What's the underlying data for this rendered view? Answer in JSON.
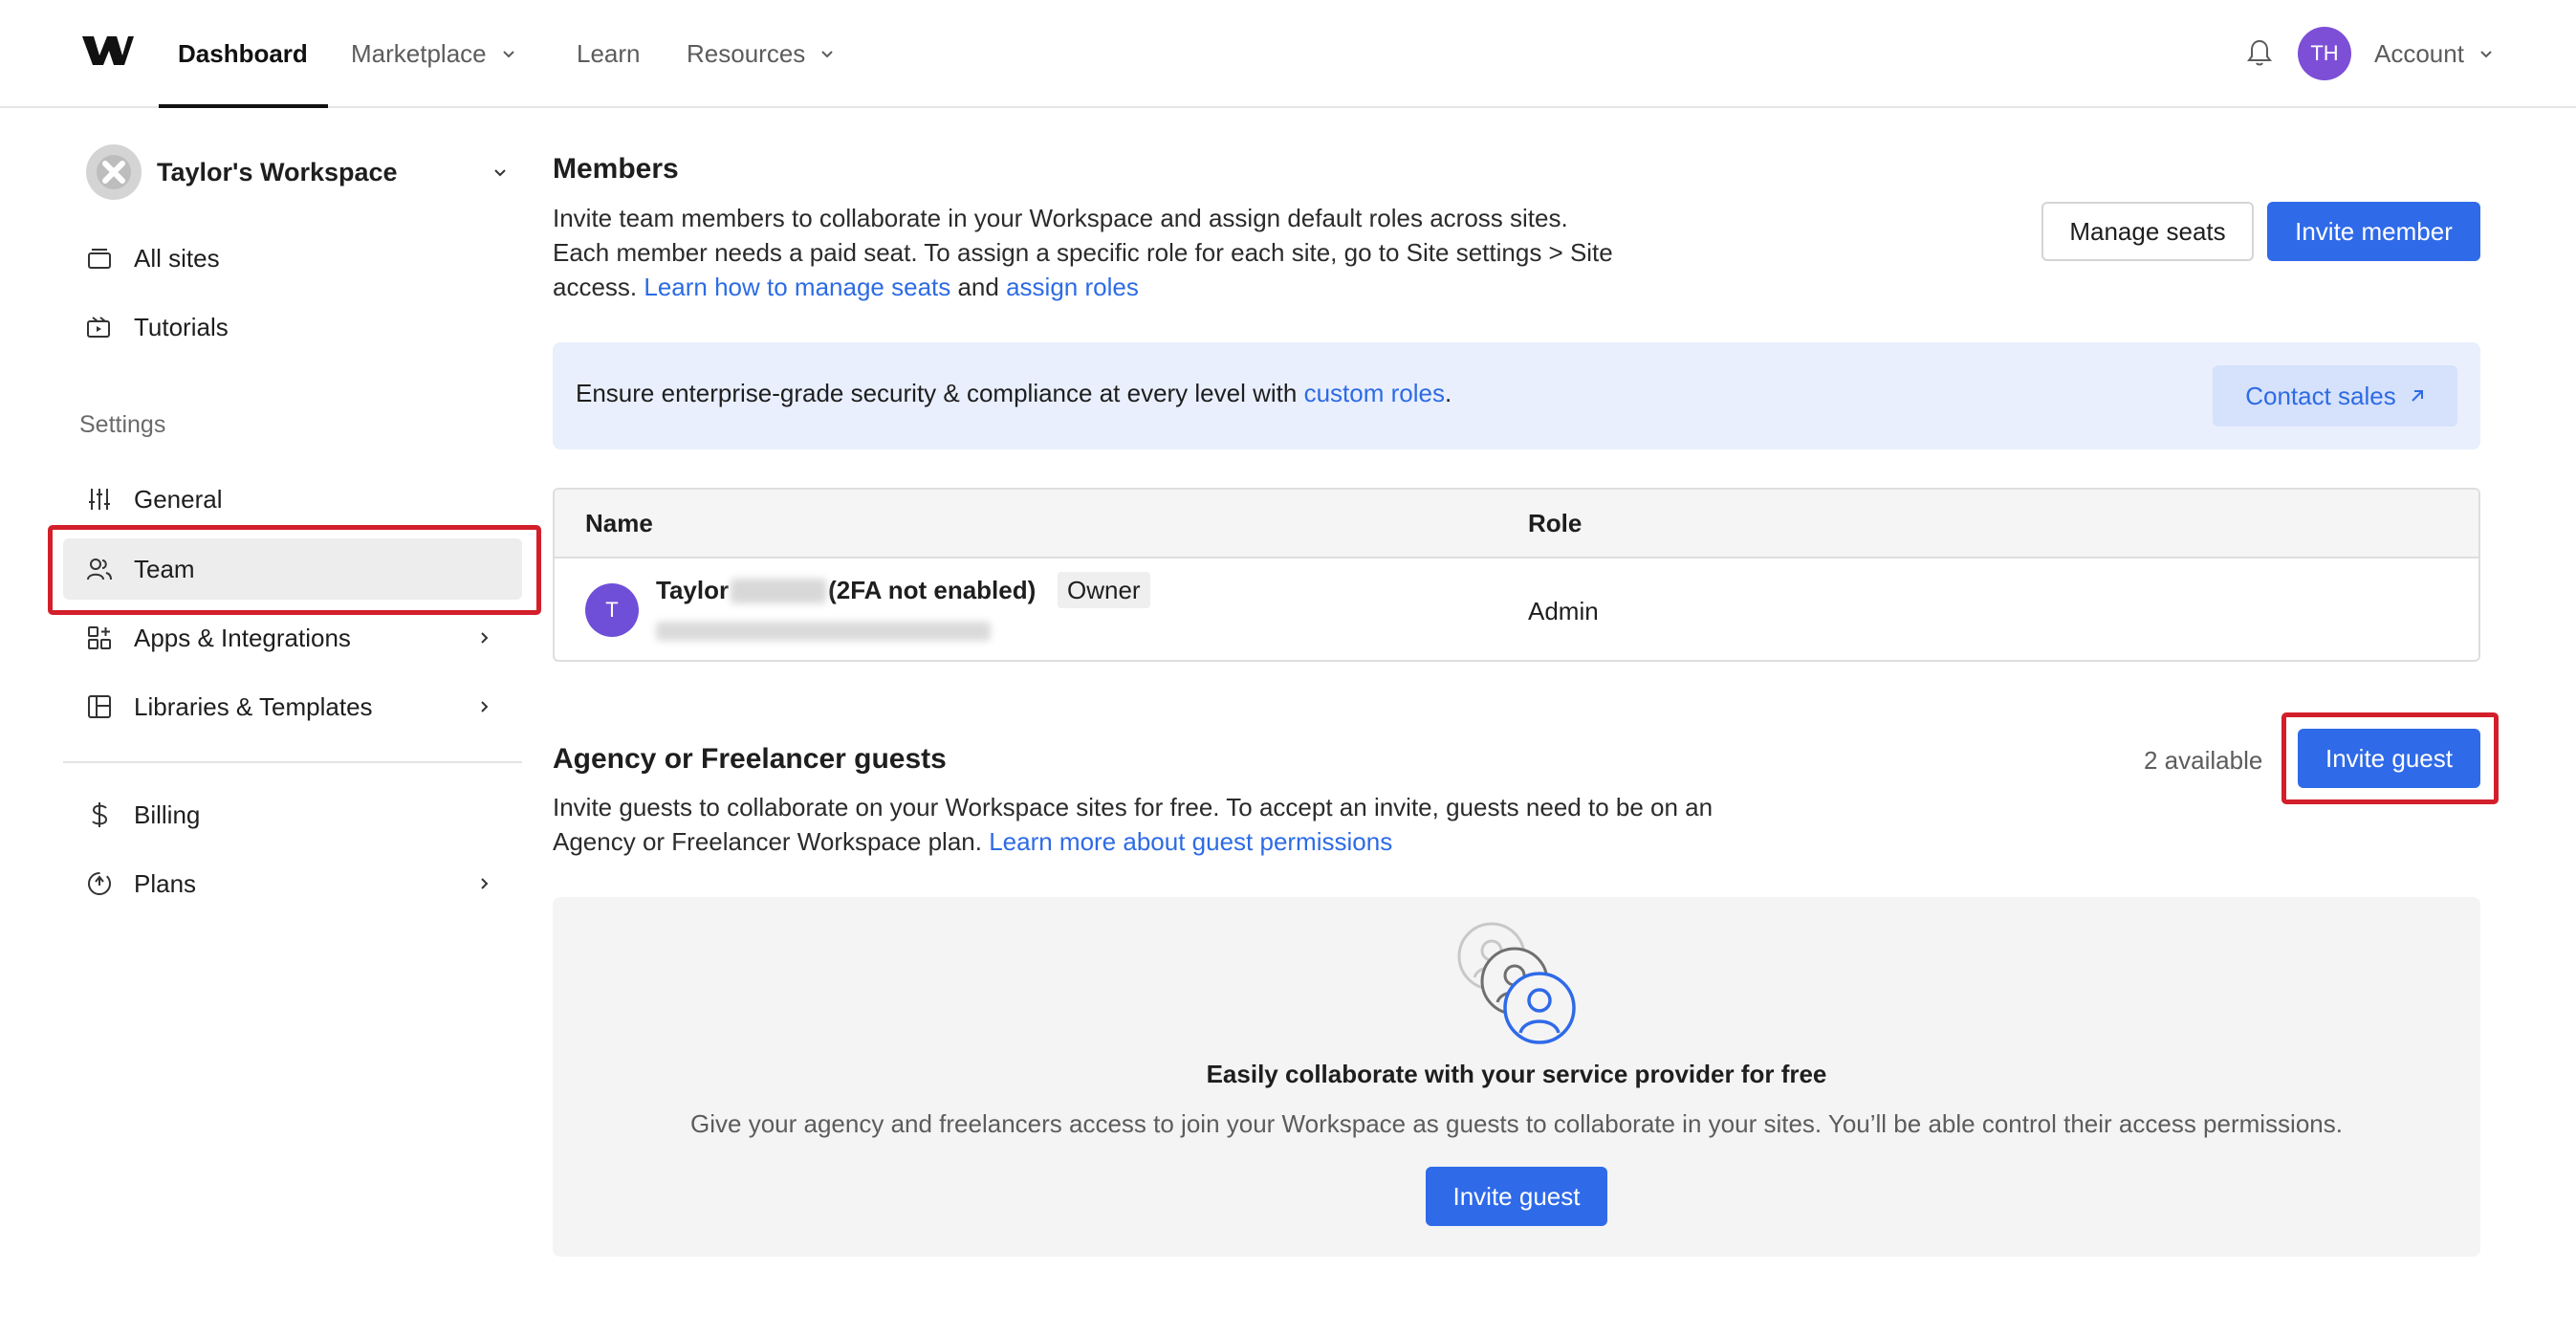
{
  "nav": {
    "logo_name": "webflow-logo",
    "items": [
      {
        "label": "Dashboard",
        "active": true,
        "dropdown": false
      },
      {
        "label": "Marketplace",
        "active": false,
        "dropdown": true
      },
      {
        "label": "Learn",
        "active": false,
        "dropdown": false
      },
      {
        "label": "Resources",
        "active": false,
        "dropdown": true
      }
    ],
    "avatar_initials": "TH",
    "account_label": "Account"
  },
  "sidebar": {
    "workspace_name": "Taylor's Workspace",
    "top_items": [
      {
        "label": "All sites",
        "icon": "sites-icon"
      },
      {
        "label": "Tutorials",
        "icon": "tutorials-icon"
      }
    ],
    "settings_heading": "Settings",
    "settings_items": [
      {
        "label": "General",
        "icon": "sliders-icon",
        "chevron": false
      },
      {
        "label": "Team",
        "icon": "team-icon",
        "chevron": false,
        "selected": true
      },
      {
        "label": "Apps & Integrations",
        "icon": "apps-icon",
        "chevron": true
      },
      {
        "label": "Libraries & Templates",
        "icon": "libraries-icon",
        "chevron": true
      }
    ],
    "bottom_items": [
      {
        "label": "Billing",
        "icon": "dollar-icon",
        "chevron": false
      },
      {
        "label": "Plans",
        "icon": "plans-icon",
        "chevron": true
      }
    ]
  },
  "members": {
    "title": "Members",
    "desc_line1": "Invite team members to collaborate in your Workspace and assign default roles across sites.",
    "desc_line2": "Each member needs a paid seat. To assign a specific role for each site, go to Site settings > Site",
    "desc_line3_prefix": "access. ",
    "link_manage": "Learn how to manage seats",
    "desc_and": " and ",
    "link_roles": "assign roles",
    "manage_seats_label": "Manage seats",
    "invite_member_label": "Invite member"
  },
  "banner": {
    "text_prefix": "Ensure enterprise-grade security & compliance at every level with ",
    "link": "custom roles",
    "text_suffix": ".",
    "cta": "Contact sales"
  },
  "table": {
    "col_name": "Name",
    "col_role": "Role",
    "rows": [
      {
        "initial": "T",
        "first_name": "Taylor",
        "status": "(2FA not enabled)",
        "badge": "Owner",
        "role": "Admin"
      }
    ]
  },
  "guests": {
    "title": "Agency or Freelancer guests",
    "available": "2 available",
    "invite_label": "Invite guest",
    "desc_line1": "Invite guests to collaborate on your Workspace sites for free. To accept an invite, guests need to be on an",
    "desc_line2_prefix": "Agency or Freelancer Workspace plan. ",
    "link": "Learn more about guest permissions",
    "empty_title": "Easily collaborate with your service provider for free",
    "empty_desc": "Give your agency and freelancers access to join your Workspace as guests to collaborate in your sites. You’ll be able control their access permissions.",
    "empty_cta": "Invite guest"
  },
  "colors": {
    "primary": "#2f6ae8",
    "highlight": "#d21f2b",
    "avatar": "#7d4fd6"
  }
}
